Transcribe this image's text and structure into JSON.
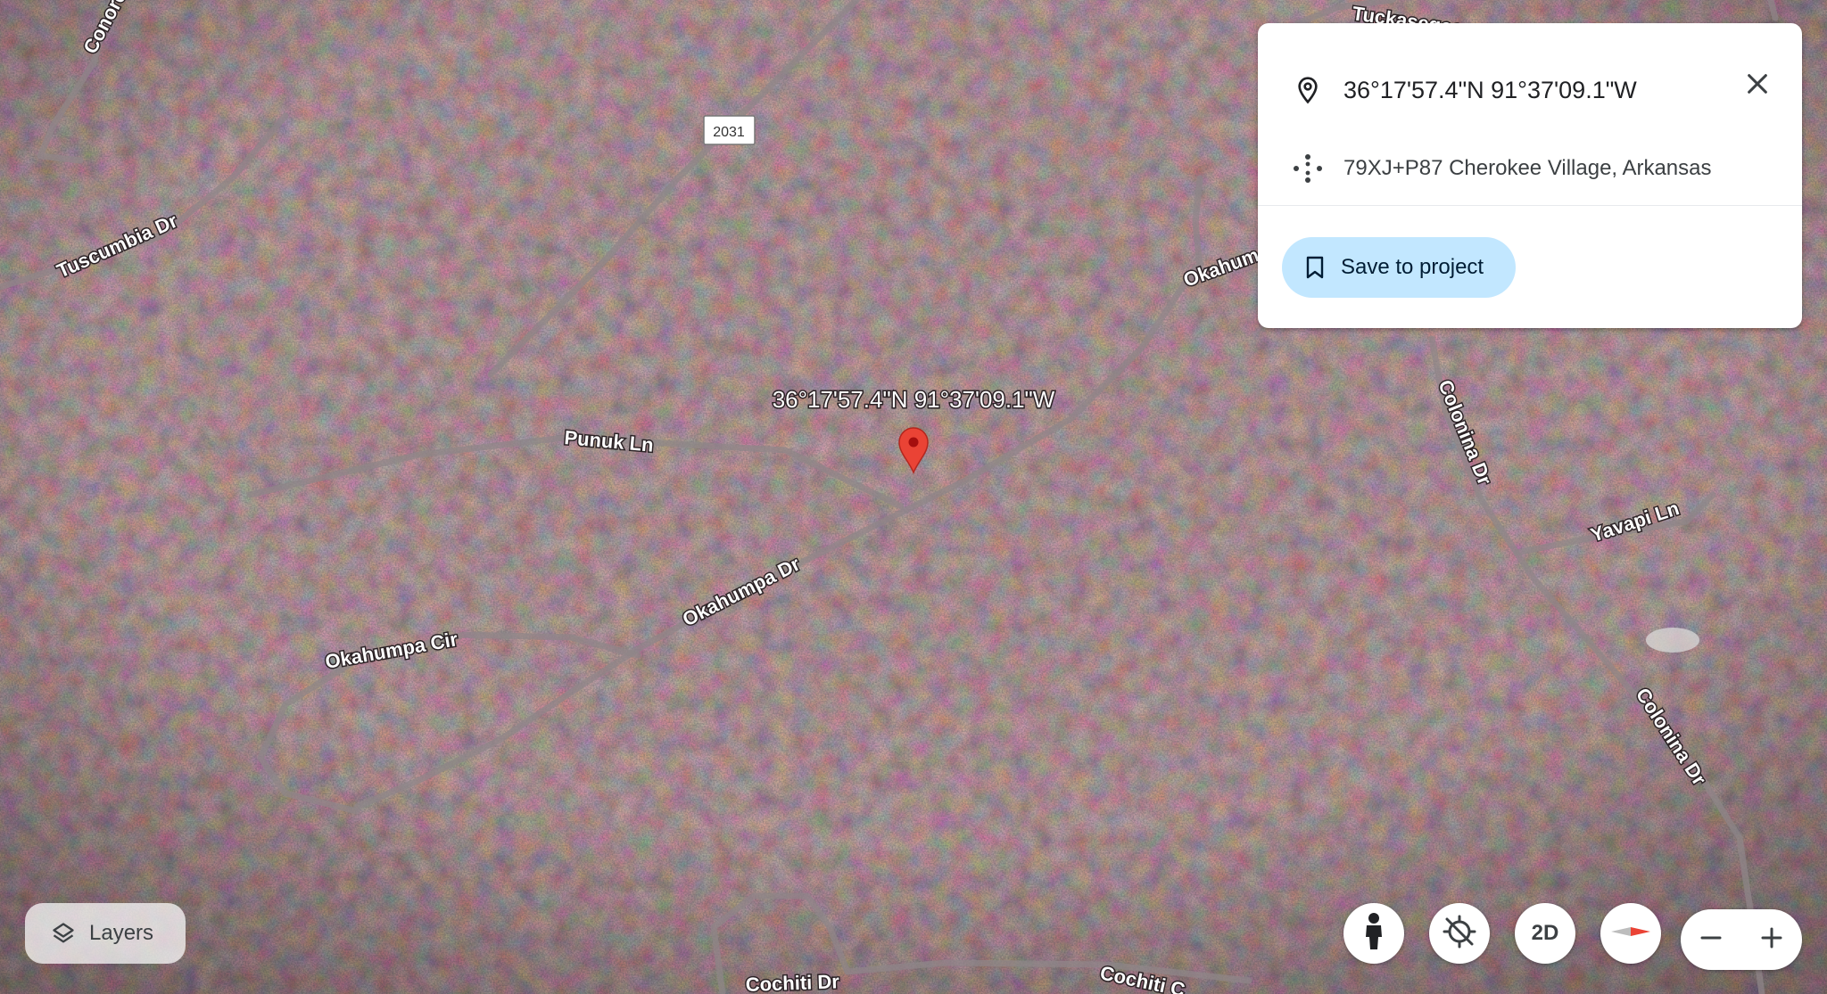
{
  "map": {
    "location_label": "36°17'57.4\"N 91°37'09.1\"W",
    "shield": "2031",
    "road_labels": {
      "conoro": "Conoro",
      "tuskasegee": "Tuckasegee",
      "tuscumbia": "Tuscumbia Dr",
      "punuk": "Punuk Ln",
      "okahumpa_dr": "Okahumpa Dr",
      "okahum": "Okahum",
      "okahumpa_cir": "Okahumpa Cir",
      "colonina_1": "Colonina Dr",
      "colonina_2": "Colonina Dr",
      "yavapi": "Yavapi Ln",
      "cochiti_dr": "Cochiti Dr",
      "cochiti_c": "Cochiti C"
    }
  },
  "info_card": {
    "coordinates": "36°17'57.4\"N 91°37'09.1\"W",
    "plus_code": "79XJ+P87 Cherokee Village, Arkansas",
    "save_label": "Save to project"
  },
  "controls": {
    "layers_label": "Layers",
    "view_2d_label": "2D"
  },
  "colors": {
    "pin": "#ea4335",
    "save_button_bg": "#c2e7ff"
  }
}
